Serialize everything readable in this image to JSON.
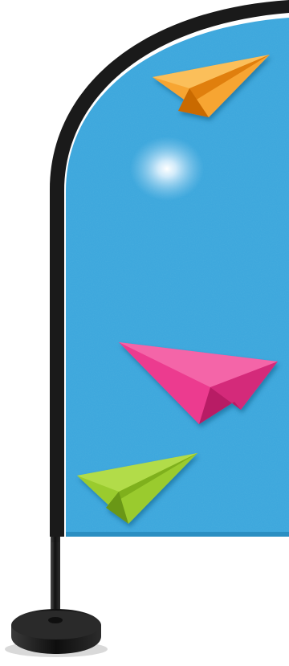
{
  "scene": {
    "subject": "feather-flag-banner",
    "colors": {
      "background": "#ffffff",
      "banner_fabric": "#3aa6dc",
      "banner_frame": "#1a1a1a",
      "pole": "#1c1c1c",
      "base": "#151515",
      "plane_orange": "#f6921e",
      "plane_pink": "#ec3a8f",
      "plane_green": "#9acb2f"
    },
    "icons": [
      "paper-plane-orange-icon",
      "paper-plane-pink-icon",
      "paper-plane-green-icon"
    ]
  }
}
